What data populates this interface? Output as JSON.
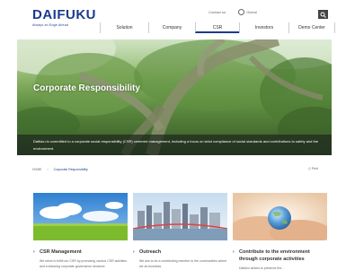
{
  "header": {
    "logo": "DAIFUKU",
    "logo_sub": "Always an Edge Ahead",
    "contact": "Contact us",
    "global": "Global",
    "nav": [
      {
        "label": "Solution",
        "name": "nav-item-solution"
      },
      {
        "label": "Company",
        "name": "nav-item-company"
      },
      {
        "label": "CSR",
        "name": "nav-item-csr",
        "active": true
      },
      {
        "label": "Investors",
        "name": "nav-item-investors"
      },
      {
        "label": "Demo Center",
        "name": "nav-item-demo-center"
      }
    ]
  },
  "hero": {
    "title": "Corporate Responsibility",
    "text": "Daifuku is committed to a corporate social responsibility (CSR) centered management, including a focus on strict compliance of social standards and contributions to safety and the environment."
  },
  "breadcrumb": {
    "home": "HOME",
    "current": "Corporate Responsibility",
    "print": "Print"
  },
  "cards": [
    {
      "title": "CSR Management",
      "desc": "We strive to fulfill our CSR by promoting various CSR activities and enhancing corporate governance structure."
    },
    {
      "title": "Outreach",
      "desc": "We aim to be a contributing member to the communities where we do business."
    },
    {
      "title": "Contribute to the environment through corporate activities",
      "desc": "Daifuku strives to preserve the..."
    }
  ],
  "colors": {
    "brand": "#1a3c8c",
    "band": "#1e281e"
  }
}
